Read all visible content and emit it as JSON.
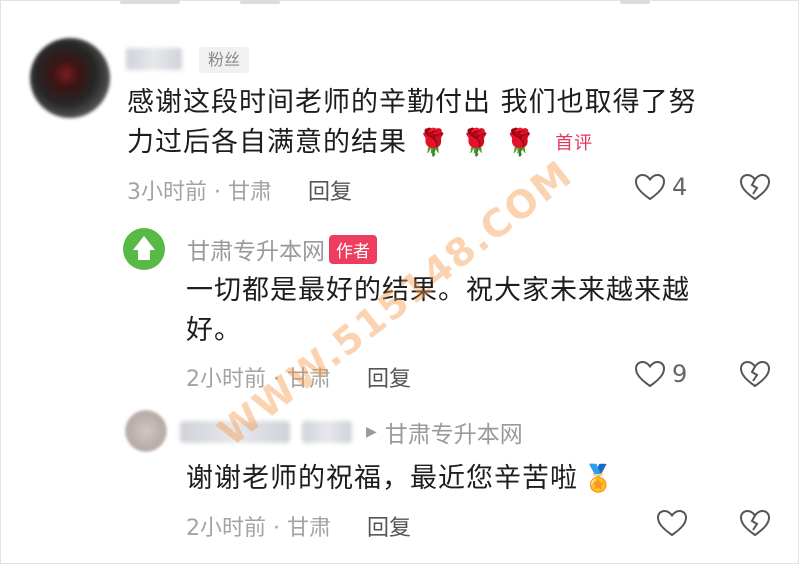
{
  "comment": {
    "badge": "粉丝",
    "text_line1": "感谢这段时间老师的辛勤付出 我们也取得了努",
    "text_line2": "力过后各自满意的结果",
    "emoji": "🌹",
    "first_tag": "首评",
    "time_location": "3小时前 · 甘肃",
    "reply_label": "回复",
    "like_count": "4"
  },
  "author_reply": {
    "name": "甘肃专升本网",
    "tag": "作者",
    "text_line1": "一切都是最好的结果。祝大家未来越来越",
    "text_line2": "好。",
    "time_location": "2小时前 · 甘肃",
    "reply_label": "回复",
    "like_count": "9"
  },
  "sub_reply": {
    "reply_to": "甘肃专升本网",
    "text": "谢谢老师的祝福，最近您辛苦啦",
    "emoji": "🏅",
    "time_location": "2小时前 · 甘肃",
    "reply_label": "回复"
  },
  "watermark": "WWW.515148.COM",
  "colors": {
    "author_badge": "#ee3d5e",
    "first_tag": "#e0385a",
    "author_avatar": "#58b946"
  }
}
